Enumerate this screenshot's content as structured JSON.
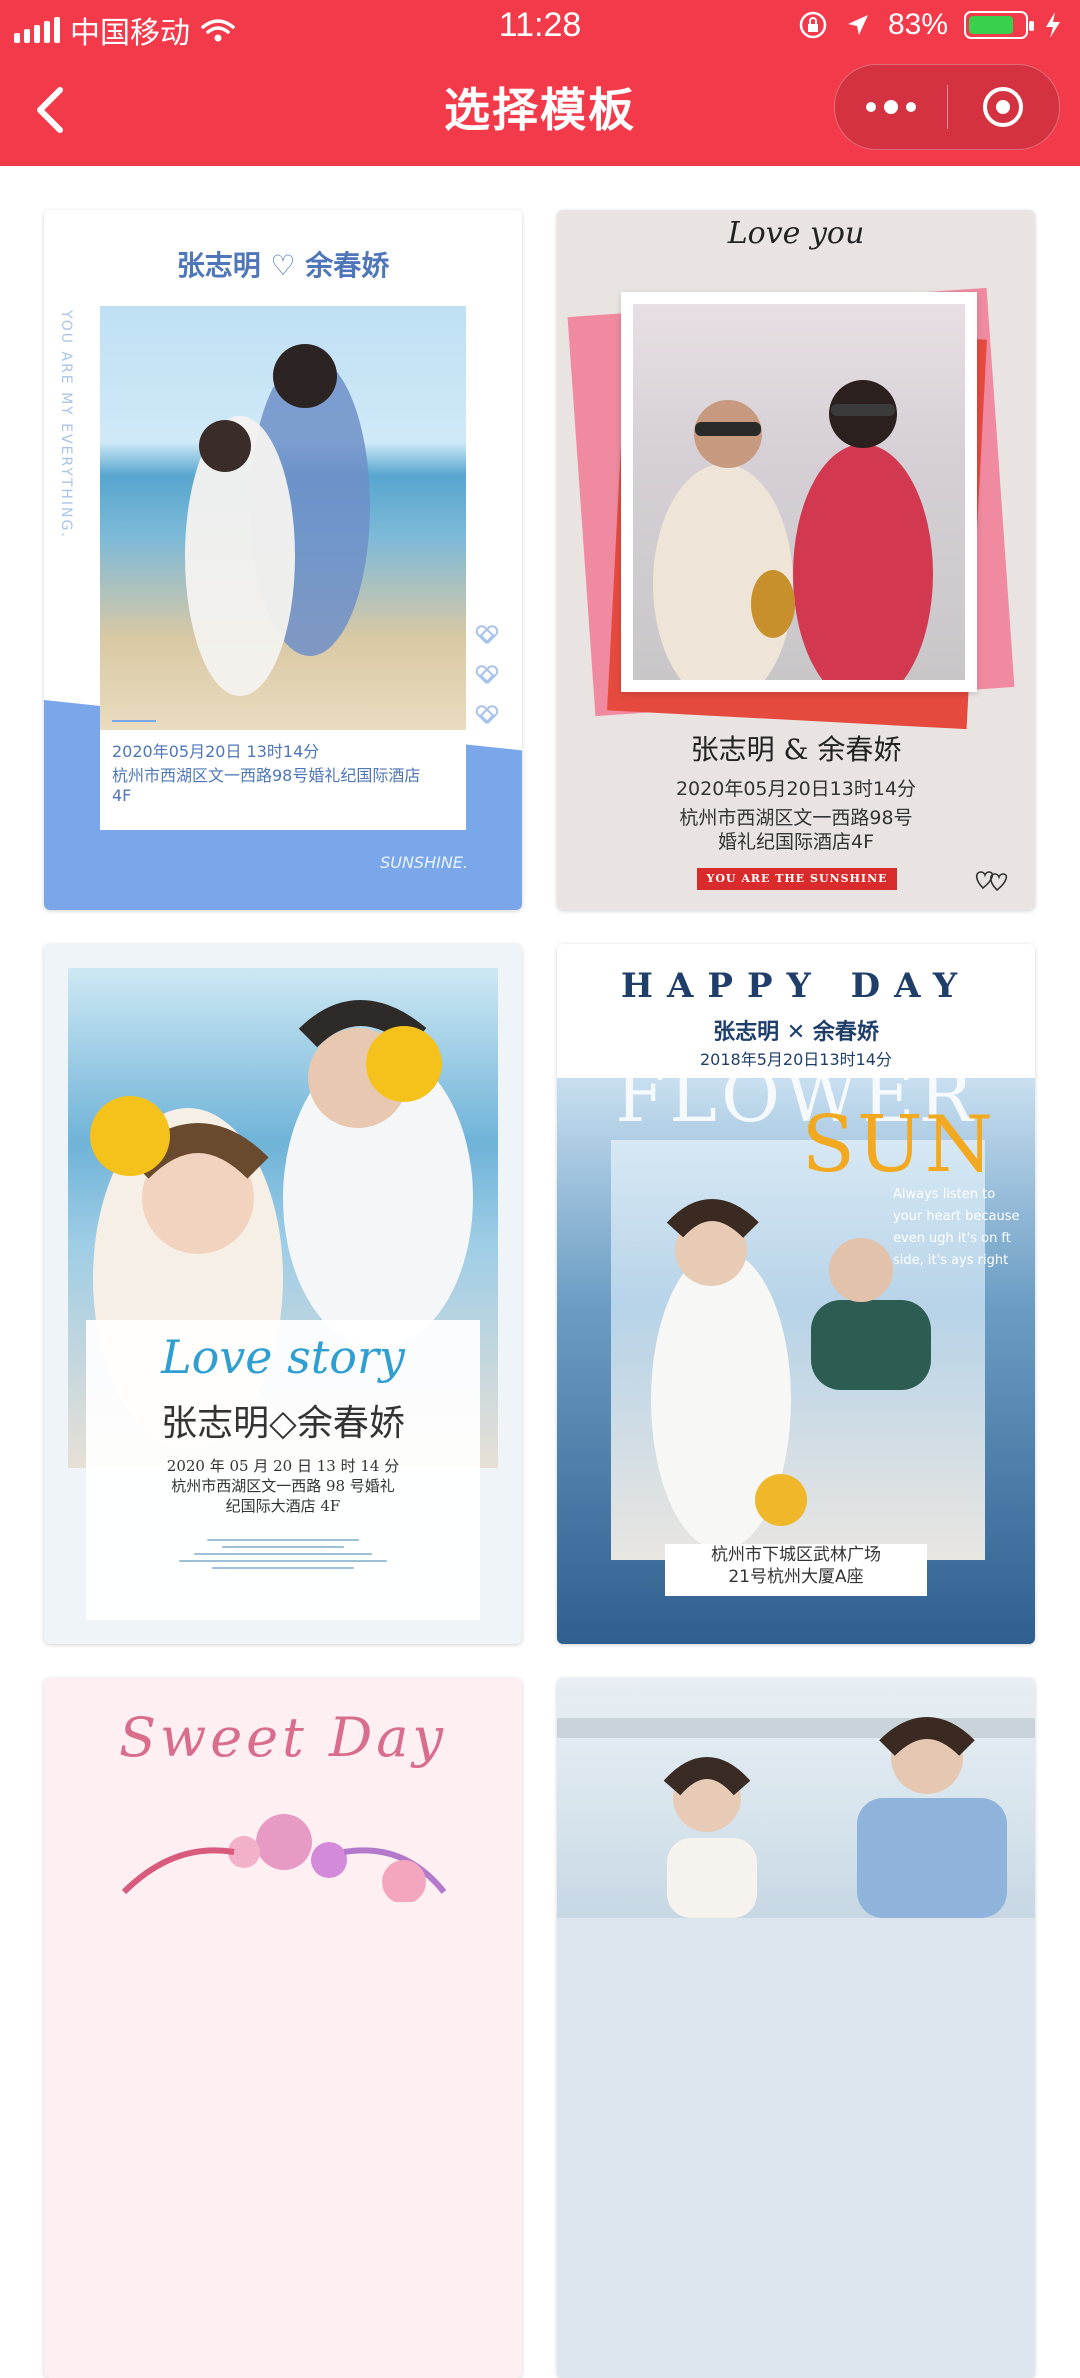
{
  "status_bar": {
    "carrier": "中国移动",
    "time": "11:28",
    "battery_percent": "83%",
    "battery_level": 0.83
  },
  "navbar": {
    "title": "选择模板"
  },
  "templates": [
    {
      "names": "张志明 ♡ 余春娇",
      "side_text": "YOU ARE MY EVERYTHING.",
      "date": "2020年05月20日 13时14分",
      "address": "杭州市西湖区文一西路98号婚礼纪国际酒店4F",
      "footer": "SUNSHINE."
    },
    {
      "headline": "Love you",
      "names": "张志明 & 余春娇",
      "date": "2020年05月20日13时14分",
      "address_line1": "杭州市西湖区文一西路98号",
      "address_line2": "婚礼纪国际酒店4F",
      "tag": "YOU ARE THE SUNSHINE"
    },
    {
      "headline": "Love story",
      "names": "张志明◇余春娇",
      "date": "2020 年 05 月 20 日 13 时 14 分",
      "address_line1": "杭州市西湖区文一西路 98 号婚礼",
      "address_line2": "纪国际大酒店 4F"
    },
    {
      "headline": "HAPPY DAY",
      "names": "张志明 ✕ 余春娇",
      "date": "2018年5月20日13时14分",
      "bg_word1": "FLOWER",
      "bg_word2": "SUN",
      "quote": "Always listen to your heart because even ugh it's on ft side, it's ays right",
      "address_line1": "杭州市下城区武林广场",
      "address_line2": "21号杭州大厦A座"
    },
    {
      "headline": "Sweet Day"
    },
    {
      "headline": ""
    }
  ]
}
